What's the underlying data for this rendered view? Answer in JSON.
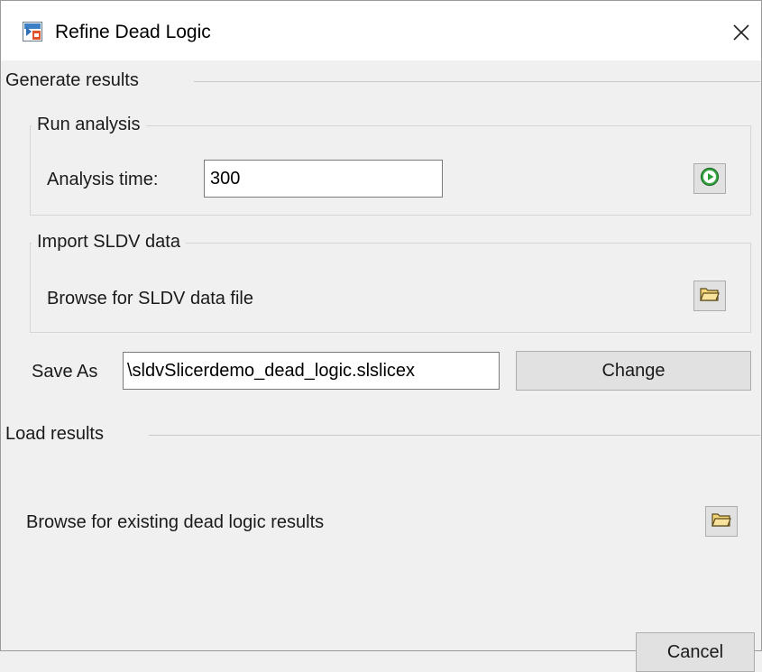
{
  "window": {
    "title": "Refine Dead Logic",
    "app_icon": "simulink-model-icon",
    "close_icon": "close-icon"
  },
  "generate_results": {
    "header": "Generate results",
    "run_analysis": {
      "title": "Run analysis",
      "analysis_time_label": "Analysis time:",
      "analysis_time_value": "300",
      "run_icon": "play-icon"
    },
    "import_sldv": {
      "title": "Import SLDV data",
      "browse_label": "Browse for SLDV data file",
      "browse_icon": "folder-open-icon"
    },
    "save_as": {
      "label": "Save As",
      "value": "\\sldvSlicerdemo_dead_logic.slslicex",
      "change_label": "Change"
    }
  },
  "load_results": {
    "header": "Load results",
    "browse_label": "Browse for existing dead logic results",
    "browse_icon": "folder-open-icon"
  },
  "footer": {
    "cancel_label": "Cancel"
  },
  "colors": {
    "accent_green": "#2e9e3a",
    "folder_yellow": "#f5d57a"
  }
}
